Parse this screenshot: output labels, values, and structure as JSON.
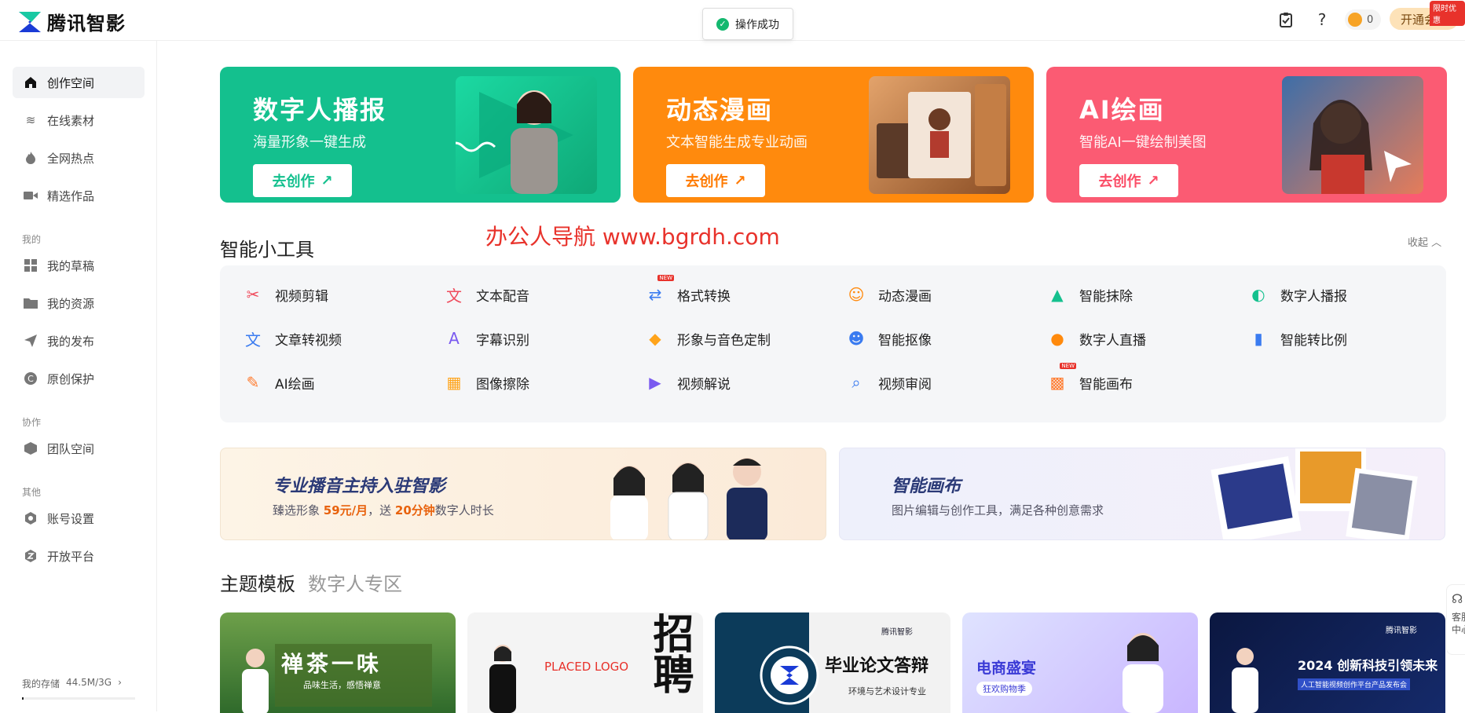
{
  "app": {
    "name": "腾讯智影"
  },
  "toast": {
    "text": "操作成功"
  },
  "header": {
    "coins": "0",
    "vip_label": "开通会员",
    "vip_badge": "限时优惠",
    "icons": [
      "clipboard-icon",
      "help-icon",
      "coin-icon"
    ]
  },
  "sidebar": {
    "items": [
      {
        "label": "创作空间",
        "icon": "home-icon",
        "active": true
      },
      {
        "label": "在线素材",
        "icon": "layers-icon"
      },
      {
        "label": "全网热点",
        "icon": "flame-icon"
      },
      {
        "label": "精选作品",
        "icon": "video-icon"
      }
    ],
    "group_mine": "我的",
    "mine_items": [
      {
        "label": "我的草稿",
        "icon": "grid-icon"
      },
      {
        "label": "我的资源",
        "icon": "folder-icon"
      },
      {
        "label": "我的发布",
        "icon": "send-icon"
      },
      {
        "label": "原创保护",
        "icon": "copyright-icon"
      }
    ],
    "group_collab": "协作",
    "collab_items": [
      {
        "label": "团队空间",
        "icon": "cube-icon"
      }
    ],
    "group_other": "其他",
    "other_items": [
      {
        "label": "账号设置",
        "icon": "settings-icon"
      },
      {
        "label": "开放平台",
        "icon": "platform-icon"
      }
    ],
    "storage_label": "我的存储",
    "storage_value": "44.5M/3G",
    "storage_fraction": 0.015
  },
  "banners": [
    {
      "title": "数字人播报",
      "subtitle": "海量形象一键生成",
      "button": "去创作",
      "color": "#14c08e",
      "btn_color": "#14c08e"
    },
    {
      "title": "动态漫画",
      "subtitle": "文本智能生成专业动画",
      "button": "去创作",
      "color": "#ff8a0d",
      "btn_color": "#ff7a00"
    },
    {
      "title": "AI绘画",
      "subtitle": "智能AI一键绘制美图",
      "button": "去创作",
      "color": "#fb5b73",
      "btn_color": "#fb4c66"
    }
  ],
  "tools_section": {
    "title": "智能小工具",
    "collapse": "收起",
    "watermark": "办公人导航 www.bgrdh.com",
    "tools": [
      {
        "label": "视频剪辑",
        "icon": "scissors-icon",
        "color": "#ef4b5c"
      },
      {
        "label": "文本配音",
        "icon": "voice-icon",
        "color": "#ef4b5c"
      },
      {
        "label": "格式转换",
        "icon": "convert-icon",
        "color": "#3a7bf0",
        "new": "NEW"
      },
      {
        "label": "动态漫画",
        "icon": "comic-icon",
        "color": "#ff8a0d"
      },
      {
        "label": "智能抹除",
        "icon": "erase-icon",
        "color": "#14c08e"
      },
      {
        "label": "数字人播报",
        "icon": "avatar-icon",
        "color": "#14c08e"
      },
      {
        "label": "文章转视频",
        "icon": "article-icon",
        "color": "#3a7bf0"
      },
      {
        "label": "字幕识别",
        "icon": "subtitle-icon",
        "color": "#7a5af0"
      },
      {
        "label": "形象与音色定制",
        "icon": "diamond-icon",
        "color": "#ffa41b"
      },
      {
        "label": "智能抠像",
        "icon": "cutout-icon",
        "color": "#3a7bf0"
      },
      {
        "label": "数字人直播",
        "icon": "live-icon",
        "color": "#ff8a0d"
      },
      {
        "label": "智能转比例",
        "icon": "ratio-icon",
        "color": "#3a7bf0"
      },
      {
        "label": "AI绘画",
        "icon": "palette-icon",
        "color": "#ff7a2d"
      },
      {
        "label": "图像擦除",
        "icon": "image-erase-icon",
        "color": "#ffa41b"
      },
      {
        "label": "视频解说",
        "icon": "narrate-icon",
        "color": "#7a5af0"
      },
      {
        "label": "视频审阅",
        "icon": "review-icon",
        "color": "#3a7bf0"
      },
      {
        "label": "智能画布",
        "icon": "canvas-icon",
        "color": "#ff7a2d",
        "new": "NEW"
      }
    ]
  },
  "promos": [
    {
      "title": "专业播音主持入驻智影",
      "subtitle_prefix": "臻选形象 ",
      "highlight1": "59元/月",
      "mid": "，送 ",
      "highlight2": "20分钟",
      "suffix": "数字人时长"
    },
    {
      "title": "智能画布",
      "subtitle": "图片编辑与创作工具，满足各种创意需求"
    }
  ],
  "templates": {
    "tab_active": "主题模板",
    "tab_inactive": "数字人专区",
    "cards": [
      {
        "title": "禅茶一味",
        "sub": "品味生活，感悟禅意"
      },
      {
        "title": "招聘",
        "sub": "PLACED LOGO"
      },
      {
        "title": "毕业论文答辩",
        "sub": "环境与艺术设计专业"
      },
      {
        "title": "电商盛宴",
        "sub": "狂欢购物季"
      },
      {
        "title": "2024 创新科技引领未来",
        "sub": "人工智能视频创作平台产品发布会"
      }
    ],
    "card_brand": "腾讯智影"
  },
  "float_help": "客服中心"
}
